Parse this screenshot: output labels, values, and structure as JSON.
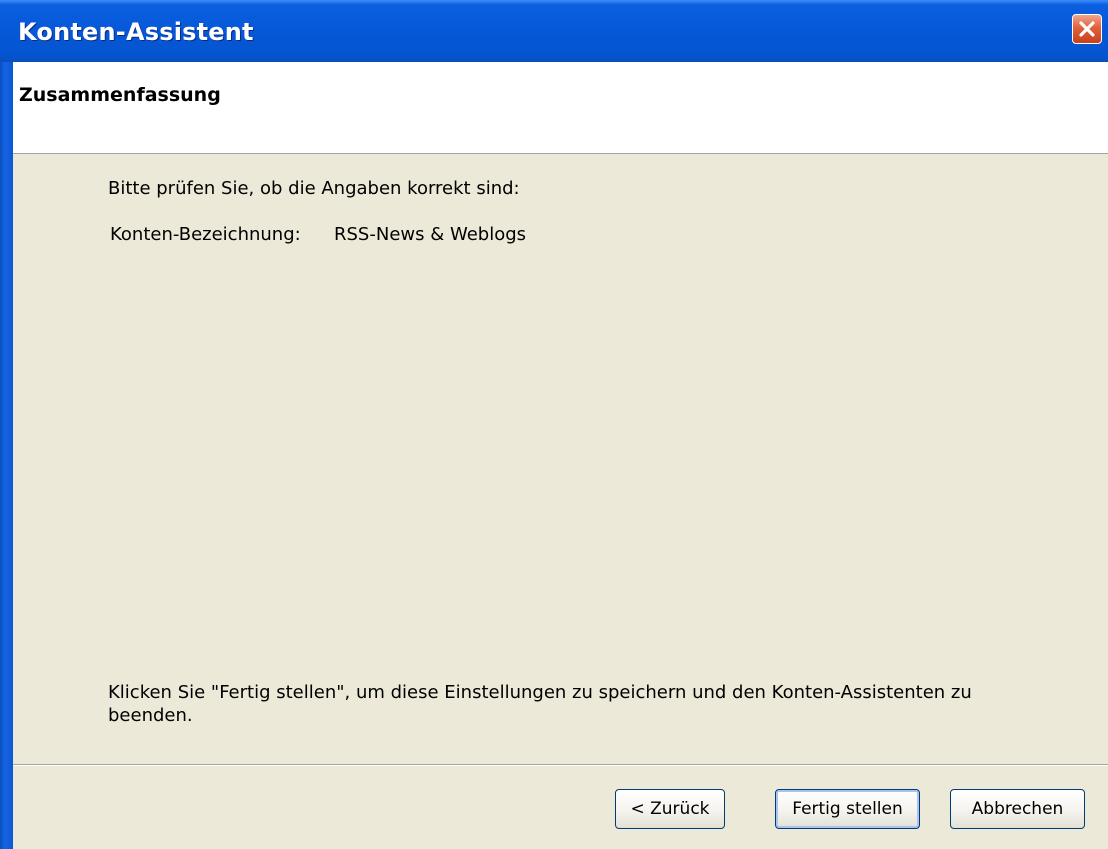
{
  "window": {
    "title": "Konten-Assistent",
    "close_icon": "close-icon"
  },
  "header": {
    "title": "Zusammenfassung"
  },
  "summary": {
    "intro": "Bitte prüfen Sie, ob die Angaben korrekt sind:",
    "rows": [
      {
        "label": "Konten-Bezeichnung:",
        "value": "RSS-News & Weblogs"
      }
    ],
    "finish_hint": "Klicken Sie \"Fertig stellen\", um diese Einstellungen zu speichern und den Konten-Assistenten zu beenden."
  },
  "buttons": {
    "back": "< Zurück",
    "finish": "Fertig stellen",
    "cancel": "Abbrechen"
  },
  "colors": {
    "titlebar": "#0758d8",
    "dialog_background": "#ece9d8",
    "close_button": "#e2603c"
  }
}
